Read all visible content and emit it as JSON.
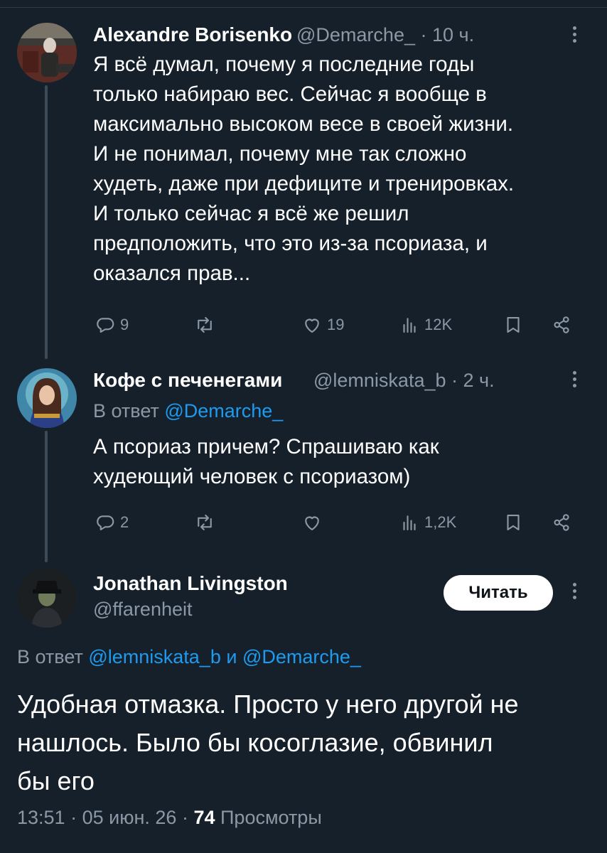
{
  "tweet1": {
    "name": "Alexandre Borisenko",
    "handle": "@Demarche_",
    "sep": "·",
    "time": "10 ч.",
    "lines": [
      "Я всё думал, почему я последние годы",
      "только набираю вес. Сейчас я вообще в",
      "максимально высоком весе в своей жизни.",
      "И не понимал, почему мне так сложно",
      "худеть, даже при дефиците и тренировках.",
      "И только сейчас я всё же решил",
      "предположить, что это из-за псориаза, и",
      "оказался прав..."
    ],
    "replies": "9",
    "retweets": "",
    "likes": "19",
    "views": "12K"
  },
  "tweet2": {
    "name": "Кофе с печенегами",
    "handle": "@lemniskata_b",
    "sep": "·",
    "time": "2 ч.",
    "reply_prefix": "В ответ",
    "reply_to": "@Demarche_",
    "lines": [
      "А псориаз причем? Спрашиваю как",
      "худеющий человек с псориазом)"
    ],
    "replies": "2",
    "retweets": "",
    "likes": "",
    "views": "1,2K"
  },
  "tweet3": {
    "name": "Jonathan Livingston",
    "handle": "@ffarenheit",
    "follow_label": "Читать",
    "reply_prefix": "В ответ",
    "reply_to_1": "@lemniskata_b",
    "reply_and": "и",
    "reply_to_2": "@Demarche_",
    "lines": [
      "Удобная отмазка. Просто у него другой не",
      "нашлось. Было бы косоглазие, обвинил",
      "бы его"
    ],
    "time": "13:51",
    "sep": "·",
    "date": "05 июн. 26",
    "views_count": "74",
    "views_label": "Просмотры"
  },
  "colors": {
    "background": "#15202b",
    "text": "#ffffff",
    "muted": "#8b98a5",
    "link": "#1d9bf0"
  },
  "icons": [
    "reply-icon",
    "retweet-icon",
    "like-icon",
    "views-icon",
    "bookmark-icon",
    "share-icon",
    "more-icon"
  ]
}
